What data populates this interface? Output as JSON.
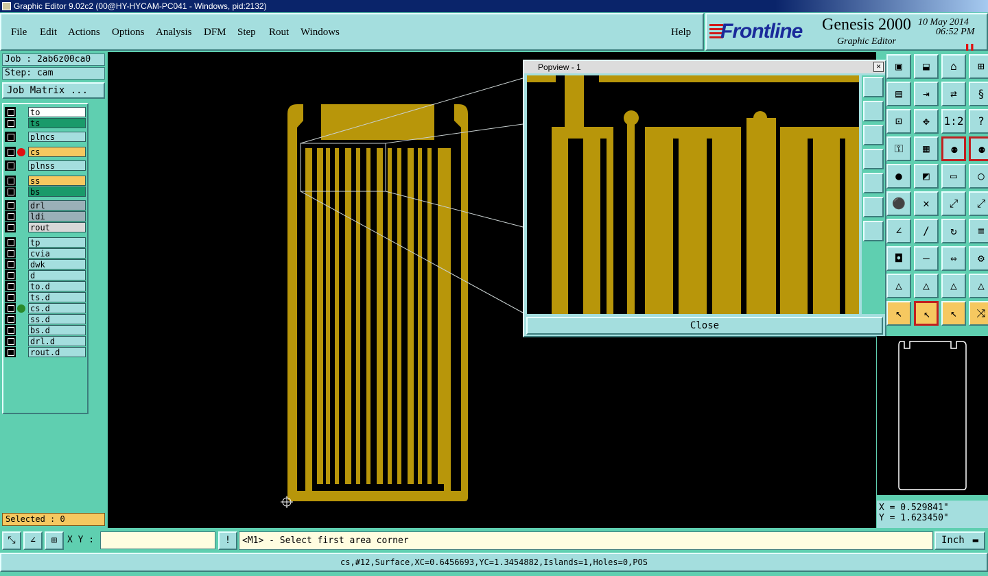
{
  "window": {
    "title": "Graphic Editor 9.02c2 (00@HY-HYCAM-PC041 - Windows, pid:2132)"
  },
  "menu": {
    "items": [
      "File",
      "Edit",
      "Actions",
      "Options",
      "Analysis",
      "DFM",
      "Step",
      "Rout",
      "Windows"
    ],
    "help": "Help"
  },
  "brand": {
    "logo": "Frontline",
    "product": "Genesis 2000",
    "subtitle": "Graphic Editor",
    "date": "10 May 2014",
    "time": "06:52 PM"
  },
  "job": {
    "job": "Job : 2ab6z00ca0",
    "step": "Step: cam",
    "matrix_button": "Job Matrix ..."
  },
  "layers": [
    {
      "name": "to",
      "color": "#ffffff",
      "dot": ""
    },
    {
      "name": "ts",
      "color": "#1a9a6a",
      "dot": ""
    },
    {
      "name": "plncs",
      "color": "#a4dede",
      "dot": ""
    },
    {
      "name": "cs",
      "color": "#f6c860",
      "dot": "#e01010"
    },
    {
      "name": "plnss",
      "color": "#a4dede",
      "dot": ""
    },
    {
      "name": "ss",
      "color": "#f6c860",
      "dot": ""
    },
    {
      "name": "bs",
      "color": "#1a9a6a",
      "dot": ""
    },
    {
      "name": "drl",
      "color": "#9ab0b8",
      "dot": ""
    },
    {
      "name": "ldi",
      "color": "#9ab0b8",
      "dot": ""
    },
    {
      "name": "rout",
      "color": "#d8d8d8",
      "dot": ""
    },
    {
      "name": "tp",
      "color": "#a4dede",
      "dot": ""
    },
    {
      "name": "cvia",
      "color": "#a4dede",
      "dot": ""
    },
    {
      "name": "dwk",
      "color": "#a4dede",
      "dot": ""
    },
    {
      "name": "d",
      "color": "#a4dede",
      "dot": ""
    },
    {
      "name": "to.d",
      "color": "#a4dede",
      "dot": ""
    },
    {
      "name": "ts.d",
      "color": "#a4dede",
      "dot": ""
    },
    {
      "name": "cs.d",
      "color": "#a4dede",
      "dot": "#2a8a2a"
    },
    {
      "name": "ss.d",
      "color": "#a4dede",
      "dot": ""
    },
    {
      "name": "bs.d",
      "color": "#a4dede",
      "dot": ""
    },
    {
      "name": "drl.d",
      "color": "#a4dede",
      "dot": ""
    },
    {
      "name": "rout.d",
      "color": "#a4dede",
      "dot": ""
    }
  ],
  "selected": "Selected : 0",
  "popview": {
    "title": "Popview - 1",
    "close": "Close"
  },
  "coords": {
    "x": "X = 0.529841\"",
    "y": "Y = 1.623450\""
  },
  "bottom": {
    "xy_label": "X Y :",
    "xy_value": "",
    "prompt": "<M1> - Select first area corner",
    "units": "Inch"
  },
  "status": "cs,#12,Surface,XC=0.6456693,YC=1.3454882,Islands=1,Holes=0,POS",
  "colors": {
    "copper": "#b8960a",
    "panel": "#5fcfb0",
    "button": "#a4dede"
  }
}
